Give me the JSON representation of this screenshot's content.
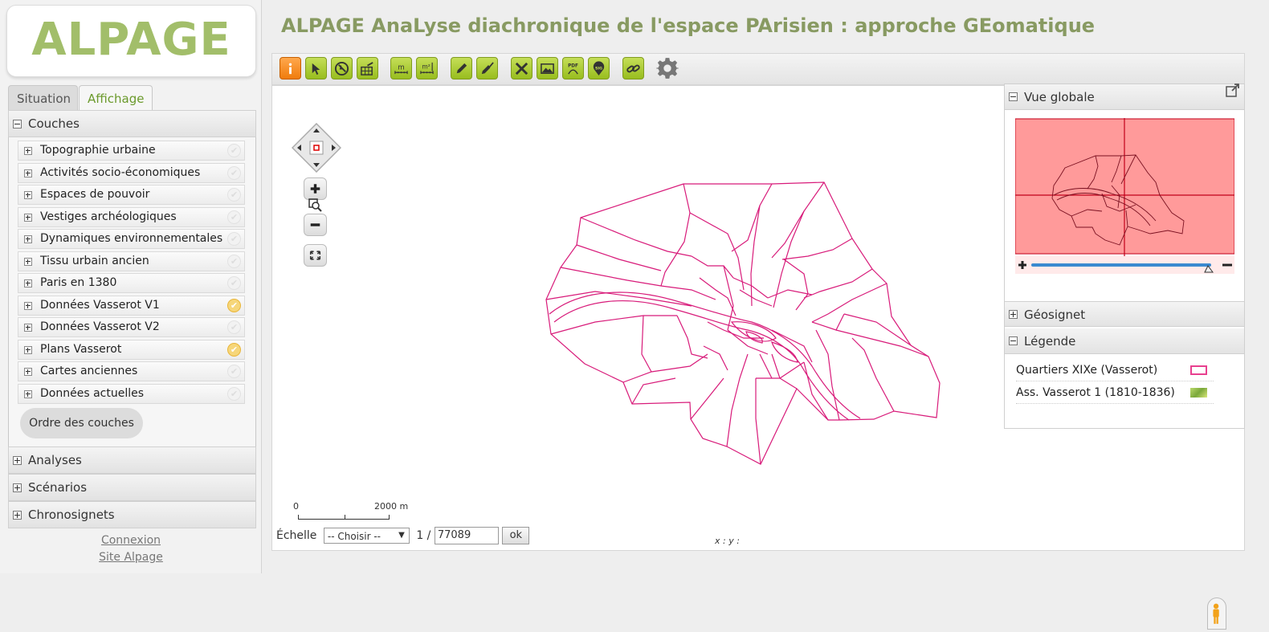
{
  "logo": {
    "text": "ALPAGE"
  },
  "app_title": "ALPAGE AnaLyse diachronique de l'espace PArisien : approche GEomatique",
  "tabs": [
    {
      "label": "Situation",
      "active": false
    },
    {
      "label": "Affichage",
      "active": true
    }
  ],
  "accordion": {
    "couches": "Couches",
    "analyses": "Analyses",
    "scenarios": "Scénarios",
    "chronosignets": "Chronosignets"
  },
  "layers": [
    {
      "label": "Topographie urbaine",
      "checked": false
    },
    {
      "label": "Activités socio-économiques",
      "checked": false
    },
    {
      "label": "Espaces de pouvoir",
      "checked": false
    },
    {
      "label": "Vestiges archéologiques",
      "checked": false
    },
    {
      "label": "Dynamiques environnementales",
      "checked": false
    },
    {
      "label": "Tissu urbain ancien",
      "checked": false
    },
    {
      "label": "Paris en 1380",
      "checked": false
    },
    {
      "label": "Données Vasserot V1",
      "checked": true
    },
    {
      "label": "Données Vasserot V2",
      "checked": false
    },
    {
      "label": "Plans Vasserot",
      "checked": true
    },
    {
      "label": "Cartes anciennes",
      "checked": false
    },
    {
      "label": "Données actuelles",
      "checked": false
    }
  ],
  "order_button": "Ordre des couches",
  "footer": {
    "login": "Connexion",
    "site": "Site Alpage"
  },
  "toolbar": {
    "icons": [
      "info-icon",
      "select-arrow-icon",
      "navigate-icon",
      "measure-grid-icon",
      "measure-m-icon",
      "measure-m2-icon",
      "edit-pencil-icon",
      "edit-check-icon",
      "export-excel-icon",
      "export-image-icon",
      "export-pdf-icon",
      "sig-icon",
      "link-icon",
      "settings-gear-icon"
    ],
    "m_label": "m",
    "m2_label": "m²",
    "pdf_label": "PDF",
    "sig_label": "SIG"
  },
  "right_panel": {
    "vue_globale": "Vue globale",
    "geosignet": "Géosignet",
    "legende": "Légende",
    "legend_items": [
      {
        "label": "Quartiers XIXe (Vasserot)",
        "color": "#e8408f"
      },
      {
        "label": "Ass. Vasserot 1 (1810-1836)",
        "color": "#8ab848"
      }
    ]
  },
  "scale": {
    "label_zero": "0",
    "label_max": "2000 m",
    "row_label": "Échelle",
    "select_value": "-- Choisir --",
    "prefix": "1 /",
    "value": "77089",
    "ok": "ok"
  },
  "coords": "x :    y :",
  "colors": {
    "accent_green": "#a2be6a",
    "map_lines": "#d81b7a",
    "overview_fill": "#ff9a9a",
    "overview_cross": "#c0001a"
  }
}
